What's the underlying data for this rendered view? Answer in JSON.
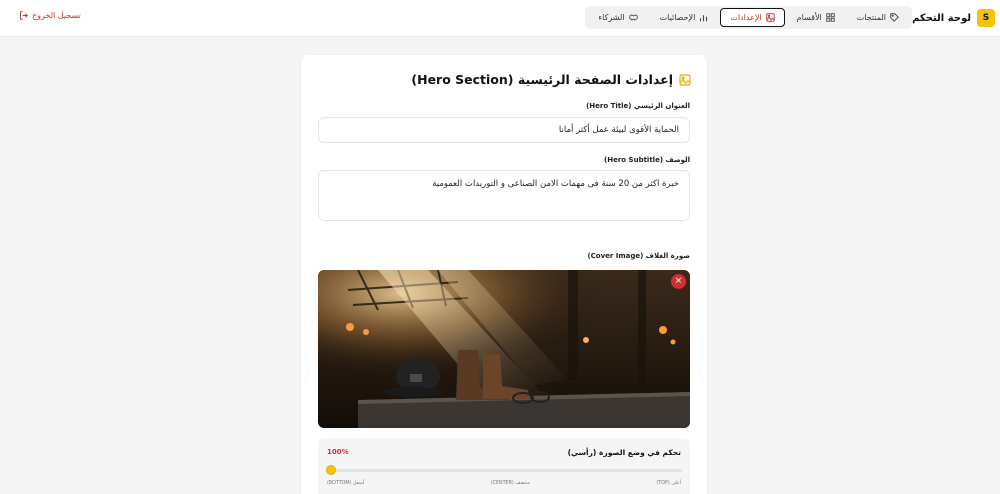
{
  "header": {
    "brand_letter": "S",
    "brand_title": "لوحة التحكم",
    "nav": [
      {
        "label": "المنتجات",
        "icon": "tag-icon",
        "active": false
      },
      {
        "label": "الأقسام",
        "icon": "grid-icon",
        "active": false
      },
      {
        "label": "الإعدادات",
        "icon": "image-icon",
        "active": true
      },
      {
        "label": "الإحصائيات",
        "icon": "bar-chart-icon",
        "active": false
      },
      {
        "label": "الشركاء",
        "icon": "handshake-icon",
        "active": false
      }
    ],
    "logout_label": "تسجيل الخروج"
  },
  "hero_settings": {
    "title": "إعدادات الصفحة الرئيسية (Hero Section)",
    "hero_title_label": "العنوان الرئيسي (Hero Title)",
    "hero_title_value": "الحماية الأقوى لبيئة عمل أكثر أمانا",
    "subtitle_label": "الوصف (Hero Subtitle)",
    "subtitle_value": "خبرة اكثر من 20 سنة فى مهمات الامن الصناعى و التوريدات العمومية",
    "cover_label": "صورة الغلاف (Cover Image)",
    "remove_symbol": "×",
    "position": {
      "title": "تحكم في وضع الصورة (رأسي)",
      "value_label": "100%",
      "value_percent": 100,
      "label_top": "أعلى (TOP)",
      "label_center": "منتصف (CENTER)",
      "label_bottom": "أسفل (BOTTOM)"
    }
  },
  "colors": {
    "accent": "#f5c400",
    "danger": "#d32f2f"
  }
}
